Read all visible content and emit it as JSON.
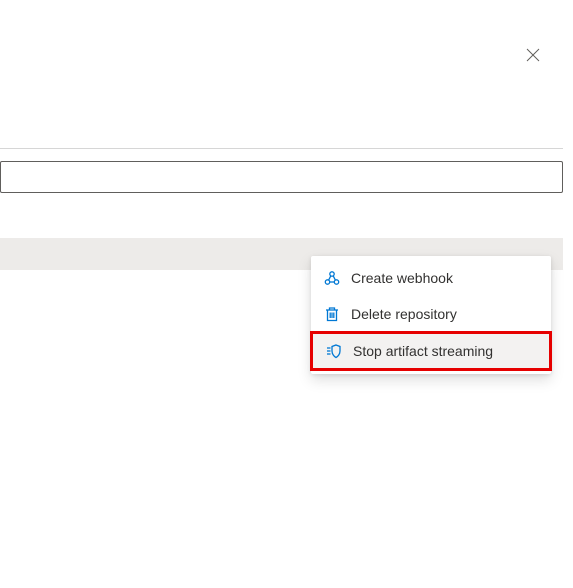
{
  "close": {
    "aria": "Close"
  },
  "input": {
    "value": "",
    "placeholder": ""
  },
  "menu": {
    "items": [
      {
        "icon": "webhook-icon",
        "label": "Create webhook"
      },
      {
        "icon": "trash-icon",
        "label": "Delete repository"
      },
      {
        "icon": "shield-stream-icon",
        "label": "Stop artifact streaming"
      }
    ]
  },
  "colors": {
    "iconBlue": "#0078d4",
    "highlightRed": "#e60000"
  }
}
